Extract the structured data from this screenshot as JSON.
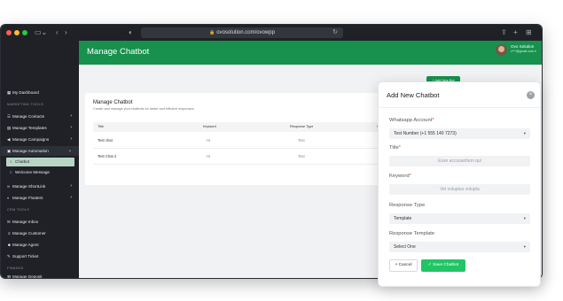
{
  "browser": {
    "url": "ovosolution.com/ovowpp"
  },
  "sidebar": {
    "items": [
      {
        "icon": "dashboard-icon",
        "glyph": "▦",
        "label": "My Dashboard"
      },
      {
        "icon": "contacts-icon",
        "glyph": "☰",
        "label": "Manage Contacts"
      },
      {
        "icon": "templates-icon",
        "glyph": "▤",
        "label": "Manage Templates"
      },
      {
        "icon": "campaigns-icon",
        "glyph": "◀",
        "label": "Manage Campaigns"
      },
      {
        "icon": "automation-icon",
        "glyph": "▣",
        "label": "Manage Automation"
      },
      {
        "icon": "chatbot-dot-icon",
        "glyph": "○",
        "label": "Chatbot"
      },
      {
        "icon": "welcome-dot-icon",
        "glyph": "○",
        "label": "Welcome Message"
      },
      {
        "icon": "shortlink-icon",
        "glyph": "∞",
        "label": "Manage ShortLink"
      },
      {
        "icon": "floaters-icon",
        "glyph": "◐",
        "label": "Manage Floaters"
      },
      {
        "icon": "inbox-icon",
        "glyph": "✉",
        "label": "Manage Inbox"
      },
      {
        "icon": "customer-icon",
        "glyph": "☺",
        "label": "Manage Customer"
      },
      {
        "icon": "agent-icon",
        "glyph": "☻",
        "label": "Manage Agent"
      },
      {
        "icon": "ticket-icon",
        "glyph": "✎",
        "label": "Support Ticket"
      },
      {
        "icon": "deposit-icon",
        "glyph": "▥",
        "label": "Manage Deposit"
      }
    ],
    "sections": {
      "marketing": "MARKETING TOOLS",
      "crm": "CRM TOOLS",
      "finance": "FINANCE"
    }
  },
  "header": {
    "title": "Manage Chatbot",
    "user_name": "Ovo Solution",
    "user_email": "c***@gmail.com"
  },
  "card": {
    "title": "Manage Chatbot",
    "subtitle": "Create and manage your chatbots for faster and efficient responses.",
    "add_button": "+ Add New Bot",
    "columns": [
      "Title",
      "Keyword",
      "Response Type",
      "Status"
    ],
    "rows": [
      {
        "title": "Test chat",
        "keyword": "Hi",
        "response_type": "Text",
        "status": true
      },
      {
        "title": "Test Chat 2",
        "keyword": "Hi",
        "response_type": "Text",
        "status": false
      }
    ]
  },
  "modal": {
    "title": "Add New Chatbot",
    "close": "×",
    "whatsapp_label": "Whatsapp Account",
    "whatsapp_value": "Test Number (+1 555 140 7273)",
    "title_label": "Title",
    "title_placeholder": "Esse accusantium qui",
    "keyword_label": "Keyword",
    "keyword_placeholder": "Vel voluptas volupta",
    "response_type_label": "Response Type",
    "response_type_value": "Template",
    "response_template_label": "Response Template",
    "response_template_value": "Select One",
    "cancel": "× Cancel",
    "save": "✓ Save Chatbot"
  },
  "colors": {
    "brand_green": "#17914d",
    "save_green": "#22c564",
    "sidebar_bg": "#1f2126"
  }
}
